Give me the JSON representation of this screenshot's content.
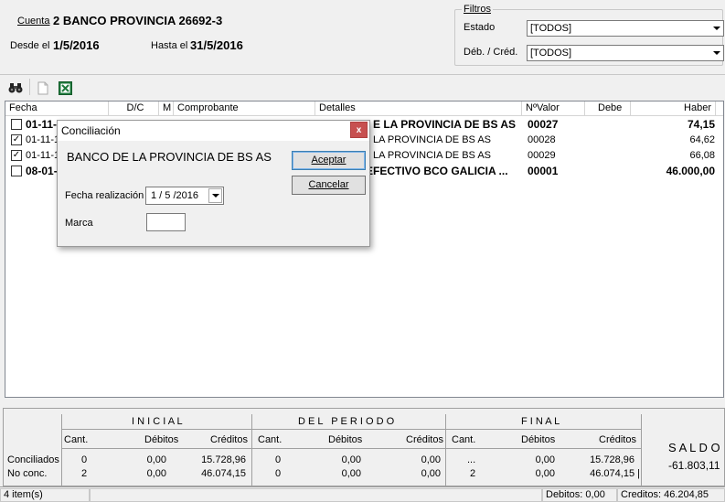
{
  "header": {
    "cuenta_label": "Cuenta",
    "cuenta_value": "2 BANCO PROVINCIA 26692-3",
    "desde_label": "Desde el",
    "desde_value": "1/5/2016",
    "hasta_label": "Hasta el",
    "hasta_value": "31/5/2016"
  },
  "filters": {
    "title": "Filtros",
    "estado_label": "Estado",
    "estado_value": "[TODOS]",
    "debcred_label": "Déb. / Créd.",
    "debcred_value": "[TODOS]"
  },
  "grid": {
    "columns": {
      "fecha": "Fecha",
      "dc": "D/C",
      "m": "M",
      "comprobante": "Comprobante",
      "detalles": "Detalles",
      "nvalor": "NºValor",
      "debe": "Debe",
      "haber": "Haber"
    },
    "rows": [
      {
        "checked": "",
        "fecha": "01-11-",
        "detalles": "E LA PROVINCIA DE BS AS",
        "nvalor": "00027",
        "haber": "74,15"
      },
      {
        "checked": "✓",
        "fecha": "01-11-1",
        "detalles": "LA PROVINCIA DE BS AS",
        "nvalor": "00028",
        "haber": "64,62"
      },
      {
        "checked": "✓",
        "fecha": "01-11-1",
        "detalles": "LA PROVINCIA DE BS AS",
        "nvalor": "00029",
        "haber": "66,08"
      },
      {
        "checked": "",
        "fecha": "08-01-",
        "detalles": "EFECTIVO BCO GALICIA ...",
        "nvalor": "00001",
        "haber": "46.000,00"
      }
    ]
  },
  "dialog": {
    "title": "Conciliación",
    "close": "x",
    "entity": "BANCO DE LA PROVINCIA DE BS AS",
    "accept": "Aceptar",
    "cancel": "Cancelar",
    "fecha_label": "Fecha realización",
    "fecha_value": "1 / 5 /2016",
    "marca_label": "Marca",
    "marca_value": ""
  },
  "summary": {
    "inicial": "I N I C I A L",
    "periodo": "D E L   P E R I O D O",
    "final": "F I N A L",
    "cant": "Cant.",
    "debitos": "Débitos",
    "creditos": "Créditos",
    "conciliados_label": "Conciliados",
    "noconc_label": "No conc.",
    "conciliados": {
      "ini_cant": "0",
      "ini_deb": "0,00",
      "ini_cred": "15.728,96",
      "per_cant": "0",
      "per_deb": "0,00",
      "per_cred": "0,00",
      "fin_cant": "...",
      "fin_deb": "0,00",
      "fin_cred": "15.728,96"
    },
    "noconc": {
      "ini_cant": "2",
      "ini_deb": "0,00",
      "ini_cred": "46.074,15",
      "per_cant": "0",
      "per_deb": "0,00",
      "per_cred": "0,00",
      "fin_cant": "2",
      "fin_deb": "0,00",
      "fin_cred": "46.074,15 |"
    },
    "saldo_label": "S A L D O",
    "saldo_value": "-61.803,11"
  },
  "status": {
    "items": "4 item(s)",
    "debitos": "Debitos: 0,00",
    "creditos": "Creditos: 46.204,85"
  }
}
